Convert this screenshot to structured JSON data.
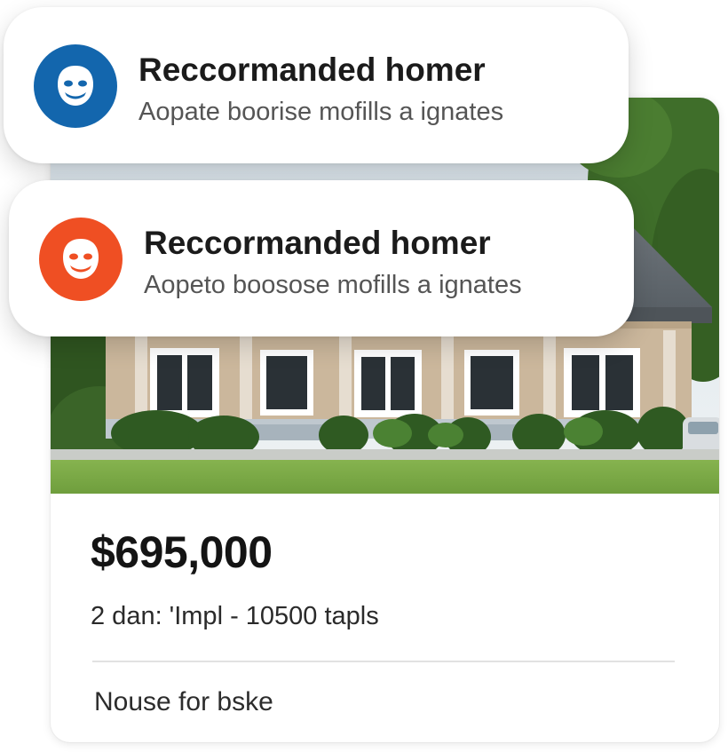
{
  "notifications": [
    {
      "title": "Reccormanded homer",
      "subtitle": "Aopate boorise mofills a ignates",
      "avatar_color": "#1366ad",
      "avatar_icon": "face-icon"
    },
    {
      "title": "Reccormanded homer",
      "subtitle": "Aopeto boosose mofills a ignates",
      "avatar_color": "#ef4f23",
      "avatar_icon": "face-icon"
    }
  ],
  "listing": {
    "price": "$695,000",
    "specs": "2 dan: 'Impl - 10500 tapls",
    "status": "Nouse for bske"
  }
}
